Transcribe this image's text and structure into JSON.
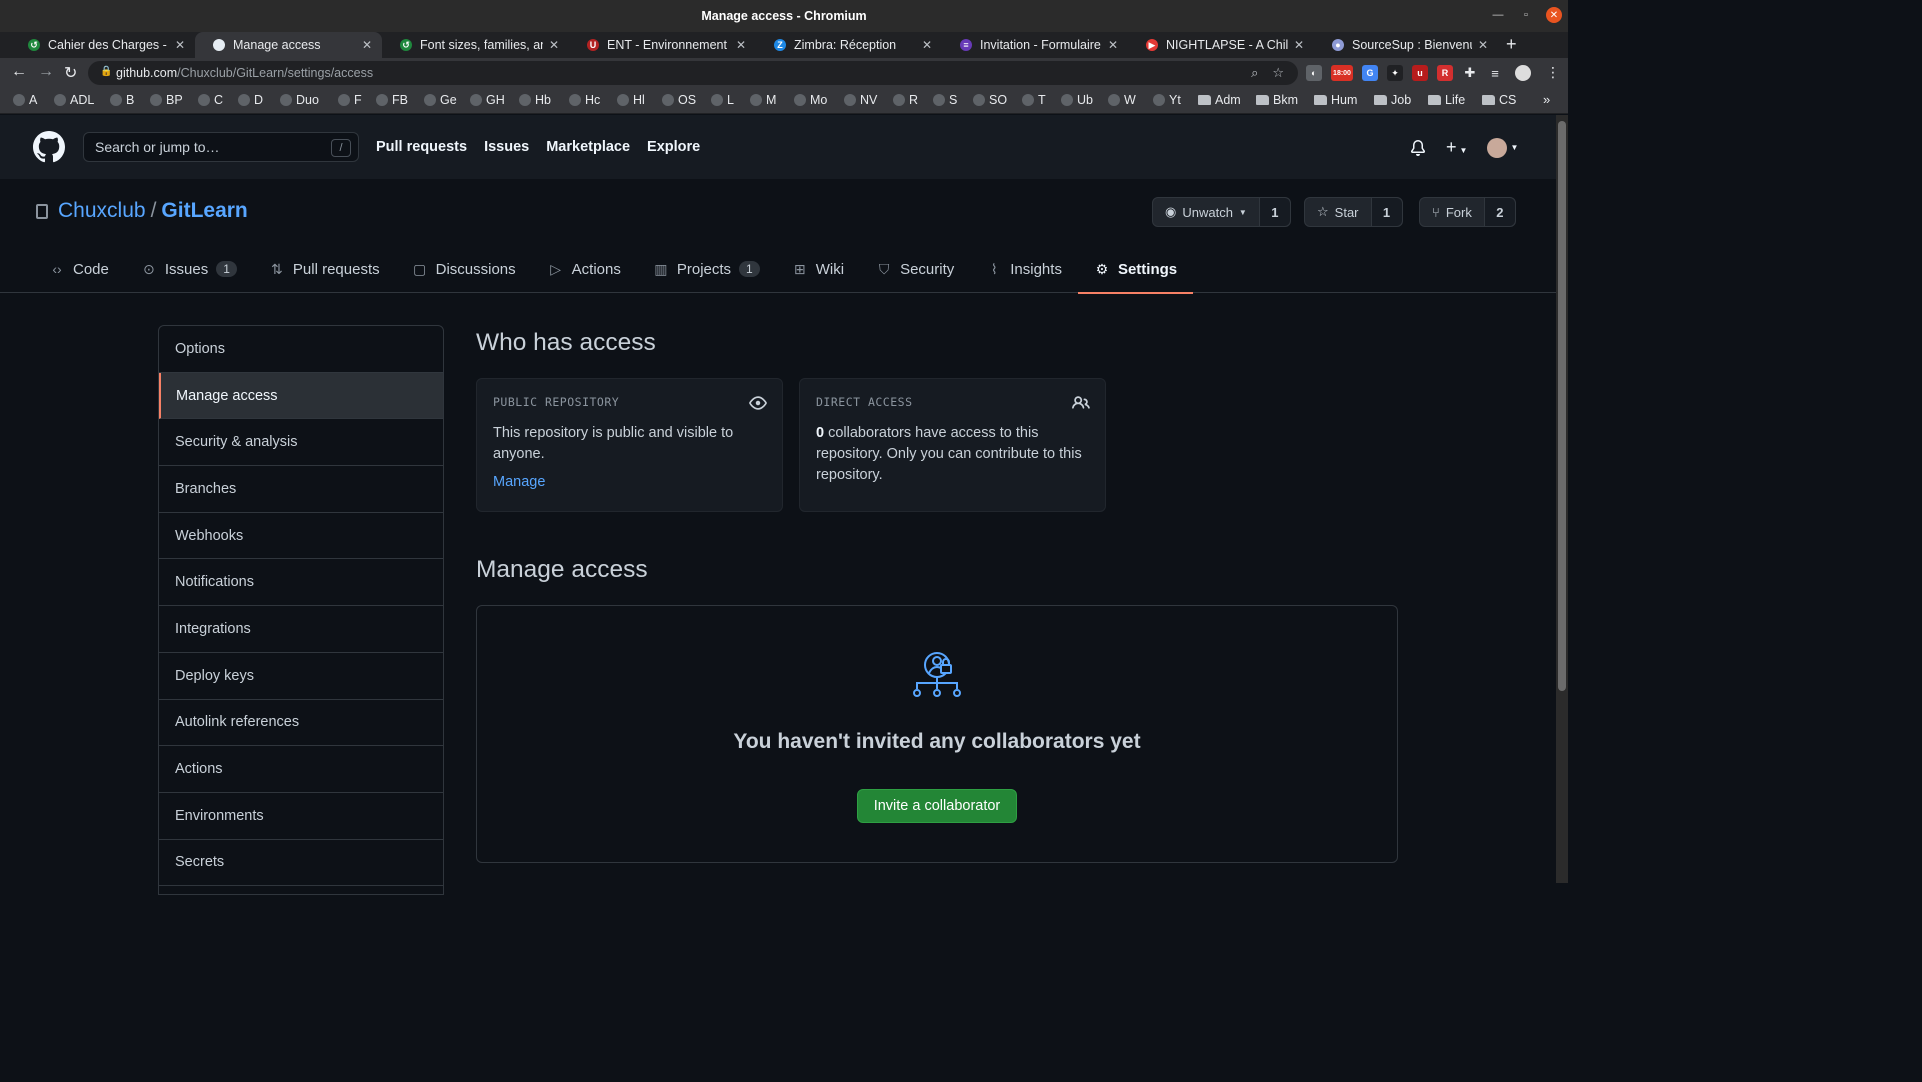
{
  "window": {
    "title": "Manage access - Chromium"
  },
  "tabs": [
    {
      "label": "Cahier des Charges - Sta",
      "fav_color": "#1f883d",
      "fav_glyph": "↺",
      "active": false
    },
    {
      "label": "Manage access",
      "fav_color": "#e6edf3",
      "fav_glyph": "",
      "active": true
    },
    {
      "label": "Font sizes, families, and",
      "fav_color": "#1f883d",
      "fav_glyph": "↺",
      "active": false
    },
    {
      "label": "ENT - Environnement Nu",
      "fav_color": "#b22222",
      "fav_glyph": "U",
      "active": false
    },
    {
      "label": "Zimbra: Réception",
      "fav_color": "#1e88e5",
      "fav_glyph": "Z",
      "active": false
    },
    {
      "label": "Invitation - Formulaire d",
      "fav_color": "#673ab7",
      "fav_glyph": "≡",
      "active": false
    },
    {
      "label": "NIGHTLAPSE - A Chill",
      "fav_color": "#e53935",
      "fav_glyph": "▶",
      "active": false
    },
    {
      "label": "SourceSup : Bienvenue",
      "fav_color": "#8e9bd6",
      "fav_glyph": "●",
      "active": false
    }
  ],
  "omnibox": {
    "url_host": "github.com",
    "url_path": "/Chuxclub/GitLearn/settings/access"
  },
  "bookmarks": [
    {
      "label": "A"
    },
    {
      "label": "ADL"
    },
    {
      "label": "B"
    },
    {
      "label": "BP"
    },
    {
      "label": "C"
    },
    {
      "label": "D"
    },
    {
      "label": "Duo"
    },
    {
      "label": "F"
    },
    {
      "label": "FB"
    },
    {
      "label": "Ge"
    },
    {
      "label": "GH"
    },
    {
      "label": "Hb"
    },
    {
      "label": "Hc"
    },
    {
      "label": "Hl"
    },
    {
      "label": "OS"
    },
    {
      "label": "L"
    },
    {
      "label": "M"
    },
    {
      "label": "Mo"
    },
    {
      "label": "NV"
    },
    {
      "label": "R"
    },
    {
      "label": "S"
    },
    {
      "label": "SO"
    },
    {
      "label": "T"
    },
    {
      "label": "Ub"
    },
    {
      "label": "W"
    },
    {
      "label": "Yt"
    }
  ],
  "bookmark_folders": [
    {
      "label": "Adm"
    },
    {
      "label": "Bkm"
    },
    {
      "label": "Hum"
    },
    {
      "label": "Job"
    },
    {
      "label": "Life"
    },
    {
      "label": "CS"
    }
  ],
  "extension_badge": "18:00",
  "github": {
    "search_placeholder": "Search or jump to…",
    "search_key": "/",
    "nav": [
      "Pull requests",
      "Issues",
      "Marketplace",
      "Explore"
    ]
  },
  "repo": {
    "owner": "Chuxclub",
    "separator": "/",
    "name": "GitLearn",
    "unwatch_label": "Unwatch",
    "unwatch_count": "1",
    "star_label": "Star",
    "star_count": "1",
    "fork_label": "Fork",
    "fork_count": "2",
    "tabs": [
      {
        "label": "Code",
        "icon": "code-icon",
        "counter": ""
      },
      {
        "label": "Issues",
        "icon": "issue-icon",
        "counter": "1"
      },
      {
        "label": "Pull requests",
        "icon": "pull-request-icon",
        "counter": ""
      },
      {
        "label": "Discussions",
        "icon": "discussions-icon",
        "counter": ""
      },
      {
        "label": "Actions",
        "icon": "play-icon",
        "counter": ""
      },
      {
        "label": "Projects",
        "icon": "project-icon",
        "counter": "1"
      },
      {
        "label": "Wiki",
        "icon": "book-icon",
        "counter": ""
      },
      {
        "label": "Security",
        "icon": "shield-icon",
        "counter": ""
      },
      {
        "label": "Insights",
        "icon": "graph-icon",
        "counter": ""
      },
      {
        "label": "Settings",
        "icon": "gear-icon",
        "counter": ""
      }
    ]
  },
  "sidebar": {
    "items": [
      "Options",
      "Manage access",
      "Security & analysis",
      "Branches",
      "Webhooks",
      "Notifications",
      "Integrations",
      "Deploy keys",
      "Autolink references",
      "Actions",
      "Environments",
      "Secrets"
    ],
    "selected": "Manage access"
  },
  "main": {
    "who_heading": "Who has access",
    "public_card": {
      "label": "PUBLIC REPOSITORY",
      "text": "This repository is public and visible to anyone.",
      "link": "Manage"
    },
    "direct_card": {
      "label": "DIRECT ACCESS",
      "count": "0",
      "text": " collaborators have access to this repository. Only you can contribute to this repository."
    },
    "manage_heading": "Manage access",
    "empty_text": "You haven't invited any collaborators yet",
    "invite_button": "Invite a collaborator"
  },
  "colors": {
    "accent": "#f78166",
    "link": "#58a6ff",
    "primary_button": "#238636",
    "background": "#0d1117"
  }
}
